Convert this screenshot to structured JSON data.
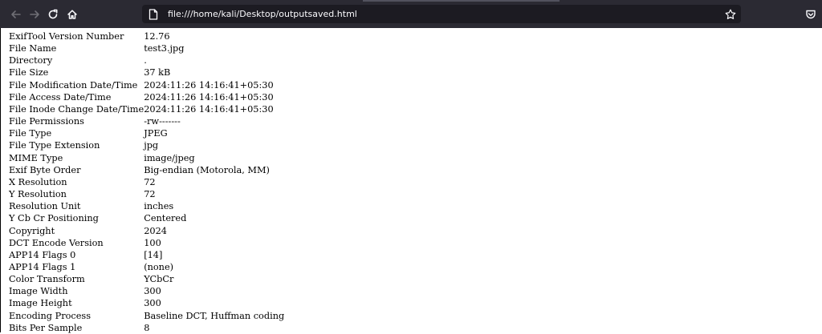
{
  "browser": {
    "url": "file:///home/kali/Desktop/outputsaved.html",
    "icons": {
      "back": "arrow-left-icon",
      "forward": "arrow-right-icon",
      "reload": "reload-icon",
      "home": "home-icon",
      "page": "page-icon",
      "bookmark": "star-icon",
      "pocket": "pocket-icon"
    },
    "colors": {
      "toolbar": "#2b2a33",
      "urlbar": "#1c1b22",
      "icon": "#fbfbfe"
    }
  },
  "rows": [
    {
      "key": "ExifTool Version Number",
      "value": "12.76"
    },
    {
      "key": "File Name",
      "value": "test3.jpg"
    },
    {
      "key": "Directory",
      "value": "."
    },
    {
      "key": "File Size",
      "value": "37 kB"
    },
    {
      "key": "File Modification Date/Time",
      "value": "2024:11:26 14:16:41+05:30"
    },
    {
      "key": "File Access Date/Time",
      "value": "2024:11:26 14:16:41+05:30"
    },
    {
      "key": "File Inode Change Date/Time",
      "value": "2024:11:26 14:16:41+05:30"
    },
    {
      "key": "File Permissions",
      "value": "-rw-------"
    },
    {
      "key": "File Type",
      "value": "JPEG"
    },
    {
      "key": "File Type Extension",
      "value": "jpg"
    },
    {
      "key": "MIME Type",
      "value": "image/jpeg"
    },
    {
      "key": "Exif Byte Order",
      "value": "Big-endian (Motorola, MM)"
    },
    {
      "key": "X Resolution",
      "value": "72"
    },
    {
      "key": "Y Resolution",
      "value": "72"
    },
    {
      "key": "Resolution Unit",
      "value": "inches"
    },
    {
      "key": "Y Cb Cr Positioning",
      "value": "Centered"
    },
    {
      "key": "Copyright",
      "value": "2024"
    },
    {
      "key": "DCT Encode Version",
      "value": "100"
    },
    {
      "key": "APP14 Flags 0",
      "value": "[14]"
    },
    {
      "key": "APP14 Flags 1",
      "value": "(none)"
    },
    {
      "key": "Color Transform",
      "value": "YCbCr"
    },
    {
      "key": "Image Width",
      "value": "300"
    },
    {
      "key": "Image Height",
      "value": "300"
    },
    {
      "key": "Encoding Process",
      "value": "Baseline DCT, Huffman coding"
    },
    {
      "key": "Bits Per Sample",
      "value": "8"
    }
  ]
}
